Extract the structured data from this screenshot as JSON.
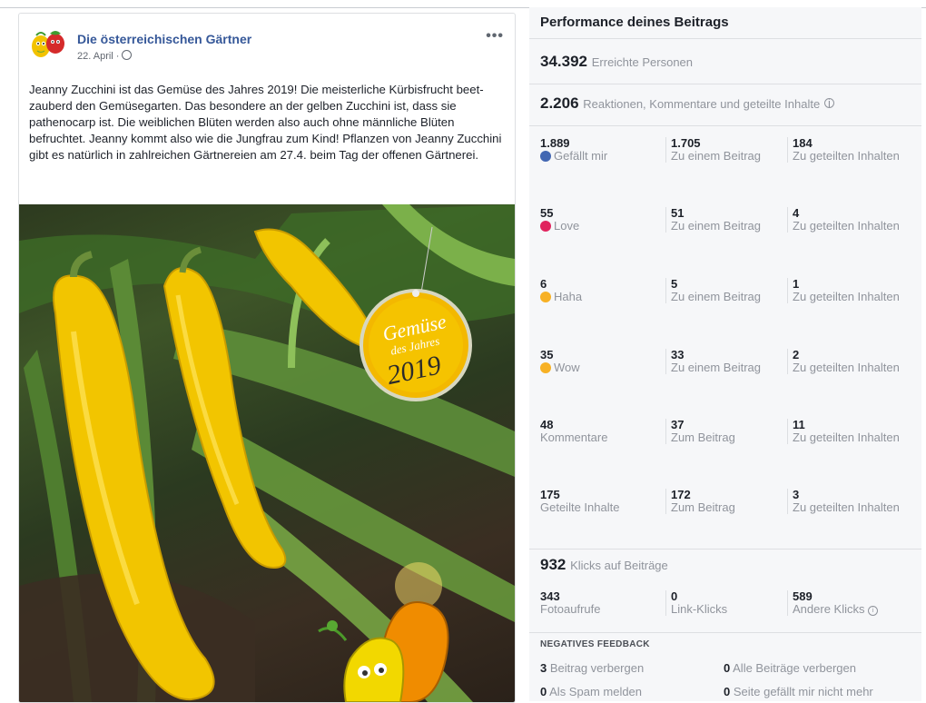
{
  "post": {
    "page_name": "Die österreichischen Gärtner",
    "date": "22. April ·",
    "more": "•••",
    "text": "Jeanny Zucchini ist das Gemüse des Jahres 2019! Die meisterliche Kürbisfrucht beet-zauberd den Gemüsegarten. Das besondere an der gelben Zucchini ist, dass sie pathenocarp ist. Die weiblichen Blüten werden also auch ohne männliche Blüten befruchtet. Jeanny kommt also wie die Jungfrau zum Kind! Pflanzen von Jeanny Zucchini gibt es natürlich in zahlreichen Gärtnereien am 27.4. beim Tag der offenen Gärtnerei.",
    "badge": {
      "line1": "Gemüse",
      "line2": "des Jahres",
      "year": "2019"
    }
  },
  "insights": {
    "title": "Performance deines Beitrags",
    "reach_value": "34.392",
    "reach_label": "Erreichte Personen",
    "reactions_value": "2.206",
    "reactions_label": "Reaktionen, Kommentare und geteilte Inhalte",
    "rows": [
      {
        "v1": "1.889",
        "l1": "Gefällt mir",
        "icon": "like-icon",
        "color": "#4267b2",
        "v2": "1.705",
        "l2": "Zu einem Beitrag",
        "v3": "184",
        "l3": "Zu geteilten Inhalten"
      },
      {
        "v1": "55",
        "l1": "Love",
        "icon": "love-icon",
        "color": "#e0245e",
        "v2": "51",
        "l2": "Zu einem Beitrag",
        "v3": "4",
        "l3": "Zu geteilten Inhalten"
      },
      {
        "v1": "6",
        "l1": "Haha",
        "icon": "haha-icon",
        "color": "#f7b125",
        "v2": "5",
        "l2": "Zu einem Beitrag",
        "v3": "1",
        "l3": "Zu geteilten Inhalten"
      },
      {
        "v1": "35",
        "l1": "Wow",
        "icon": "wow-icon",
        "color": "#f7b125",
        "v2": "33",
        "l2": "Zu einem Beitrag",
        "v3": "2",
        "l3": "Zu geteilten Inhalten"
      },
      {
        "v1": "48",
        "l1": "Kommentare",
        "icon": "",
        "color": "",
        "v2": "37",
        "l2": "Zum Beitrag",
        "v3": "11",
        "l3": "Zu geteilten Inhalten"
      },
      {
        "v1": "175",
        "l1": "Geteilte Inhalte",
        "icon": "",
        "color": "",
        "v2": "172",
        "l2": "Zum Beitrag",
        "v3": "3",
        "l3": "Zu geteilten Inhalten"
      }
    ],
    "clicks_value": "932",
    "clicks_label": "Klicks auf Beiträge",
    "click_rows": {
      "v1": "343",
      "l1": "Fotoaufrufe",
      "v2": "0",
      "l2": "Link-Klicks",
      "v3": "589",
      "l3": "Andere Klicks"
    },
    "negative_title": "NEGATIVES FEEDBACK",
    "negative": [
      {
        "value": "3",
        "label": "Beitrag verbergen"
      },
      {
        "value": "0",
        "label": "Alle Beiträge verbergen"
      },
      {
        "value": "0",
        "label": "Als Spam melden"
      },
      {
        "value": "0",
        "label": "Seite gefällt mir nicht mehr"
      }
    ]
  }
}
